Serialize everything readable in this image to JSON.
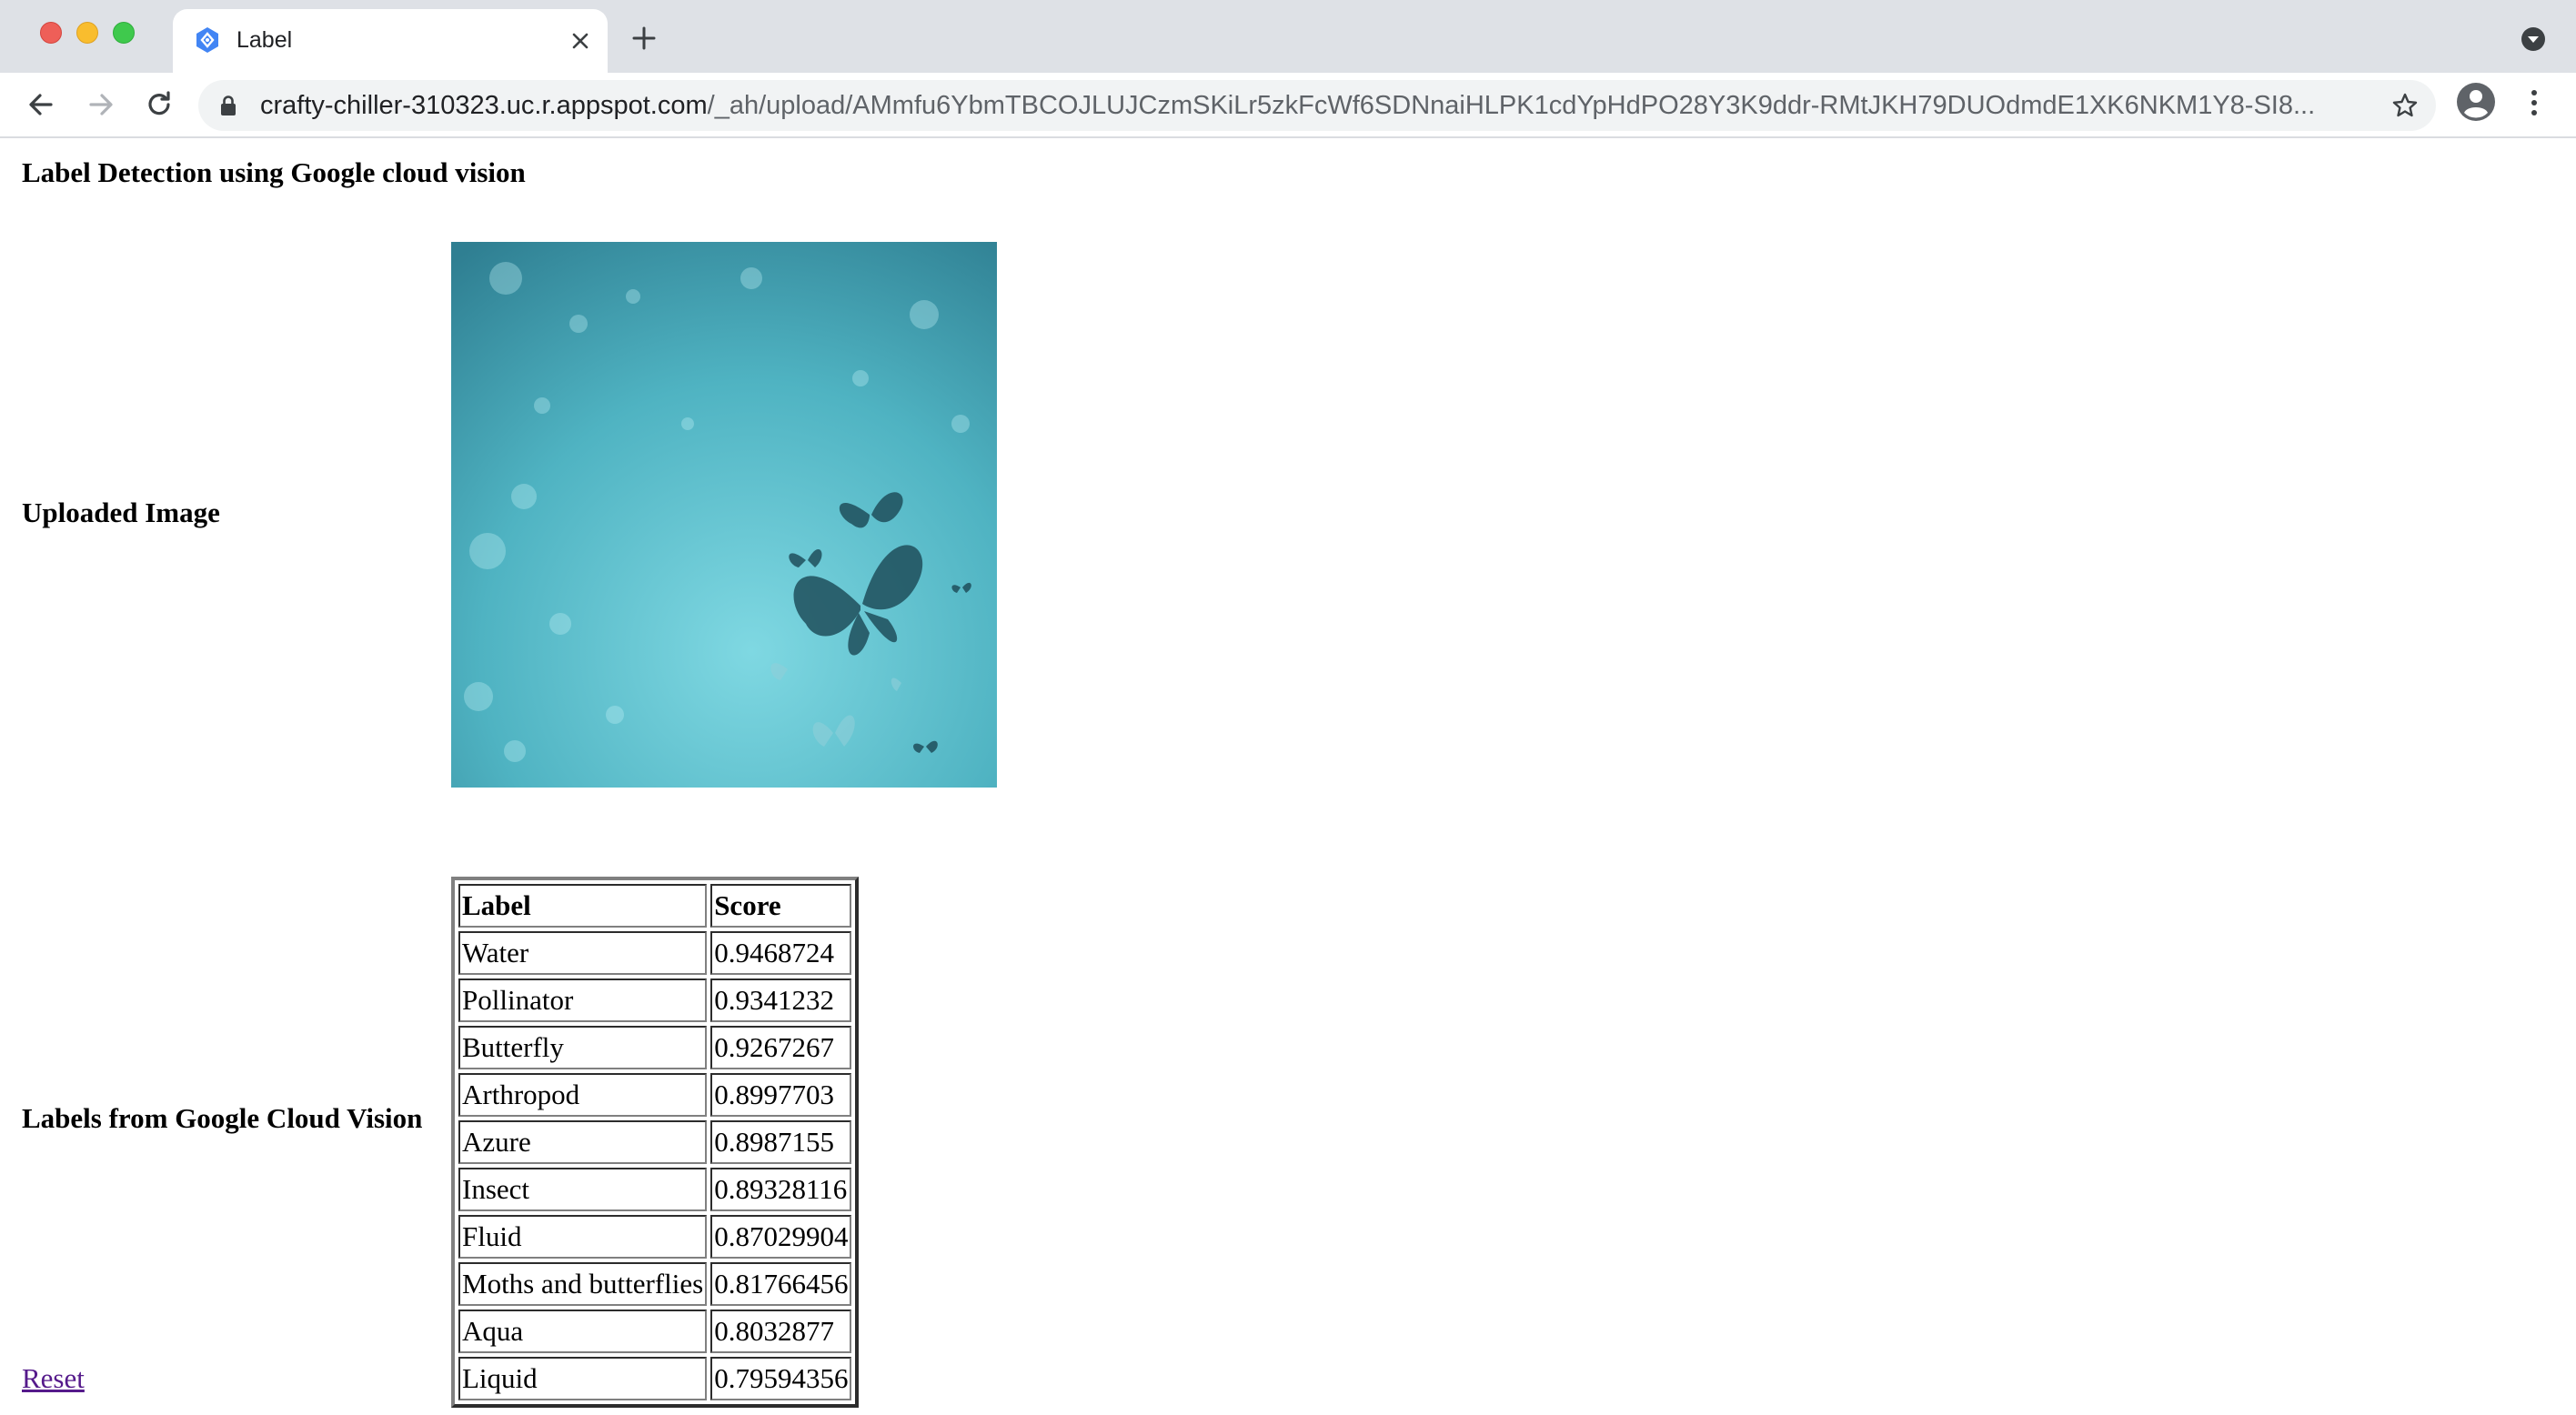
{
  "browser": {
    "tab_title": "Label",
    "url_host": "crafty-chiller-310323.uc.r.appspot.com",
    "url_path": "/_ah/upload/AMmfu6YbmTBCOJLUJCzmSKiLr5zkFcWf6SDNnaiHLPK1cdYpHdPO28Y3K9ddr-RMtJKH79DUOdmdE1XK6NKM1Y8-SI8..."
  },
  "page": {
    "heading": "Label Detection using Google cloud vision",
    "uploaded_label": "Uploaded Image",
    "vision_label": "Labels from Google Cloud Vision",
    "reset_link": "Reset"
  },
  "labels_table": {
    "headers": [
      "Label",
      "Score"
    ],
    "rows": [
      [
        "Water",
        "0.9468724"
      ],
      [
        "Pollinator",
        "0.9341232"
      ],
      [
        "Butterfly",
        "0.9267267"
      ],
      [
        "Arthropod",
        "0.8997703"
      ],
      [
        "Azure",
        "0.8987155"
      ],
      [
        "Insect",
        "0.89328116"
      ],
      [
        "Fluid",
        "0.87029904"
      ],
      [
        "Moths and butterflies",
        "0.81766456"
      ],
      [
        "Aqua",
        "0.8032877"
      ],
      [
        "Liquid",
        "0.79594356"
      ]
    ]
  },
  "colors": {
    "tabbar_bg": "#dee1e6",
    "omnibox_bg": "#f1f3f4",
    "link_visited": "#551a8b",
    "image_teal": "#4fb3c2"
  },
  "icons": [
    "close-icon",
    "plus-icon",
    "back-arrow-icon",
    "forward-arrow-icon",
    "reload-icon",
    "lock-icon",
    "star-icon",
    "profile-icon",
    "kebab-menu-icon",
    "tab-search-icon",
    "favicon-icon"
  ]
}
